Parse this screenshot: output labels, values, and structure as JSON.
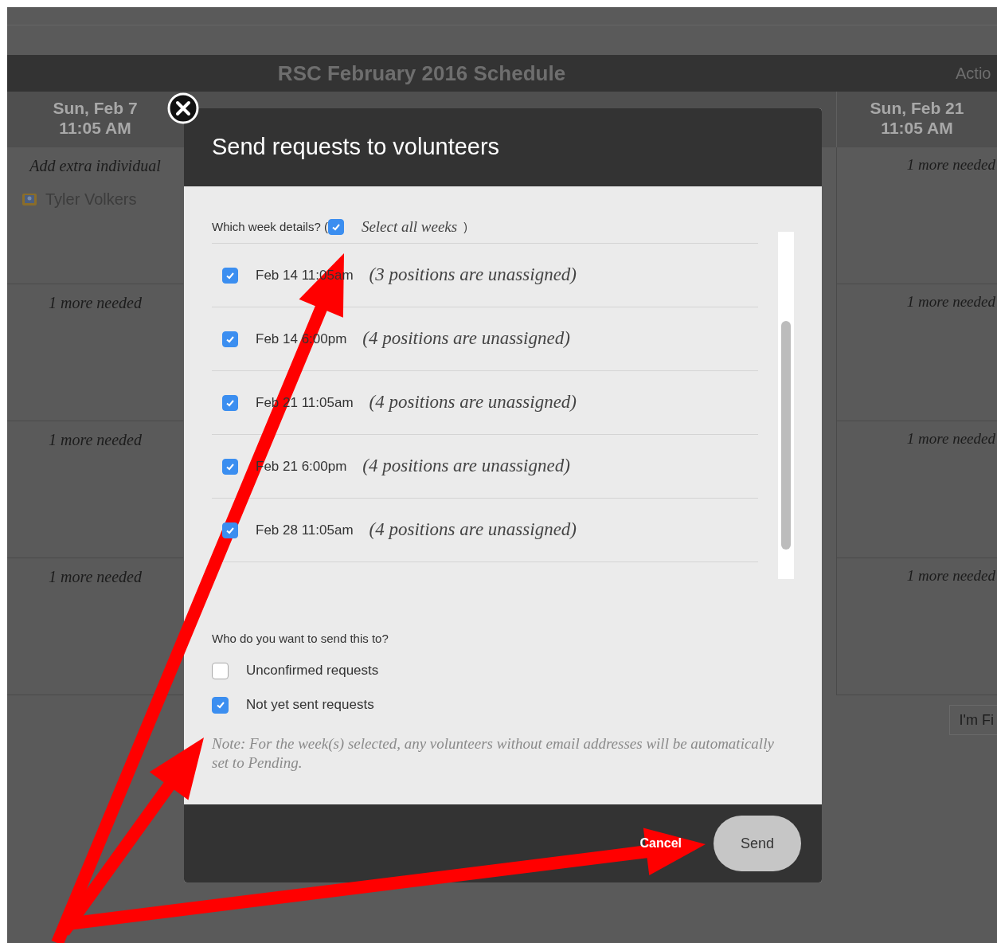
{
  "schedule": {
    "title": "RSC February 2016 Schedule",
    "actions_label": "Actio",
    "columns": [
      {
        "date": "Sun, Feb 7",
        "time": "11:05 AM"
      },
      {
        "date": "Sun, Feb 21",
        "time": "11:05 AM"
      }
    ],
    "first_column": [
      {
        "kind": "add",
        "text": "Add extra individual",
        "person": "Tyler Volkers"
      },
      {
        "kind": "needed",
        "text": "1 more needed"
      },
      {
        "kind": "needed",
        "text": "1 more needed"
      },
      {
        "kind": "needed",
        "text": "1 more needed"
      }
    ],
    "last_column": [
      "1 more needed",
      "1 more needed",
      "1 more needed",
      "1 more needed"
    ],
    "footer_button": "I'm Fi"
  },
  "dialog": {
    "title": "Send requests to volunteers",
    "week_prompt": "Which week details? (",
    "select_all": {
      "label": "Select all weeks",
      "checked": true
    },
    "week_prompt_end": ")",
    "weeks": [
      {
        "label": "Feb 14 11:05am",
        "note": "(3 positions are unassigned)",
        "checked": true
      },
      {
        "label": "Feb 14 6:00pm",
        "note": "(4 positions are unassigned)",
        "checked": true
      },
      {
        "label": "Feb 21 11:05am",
        "note": "(4 positions are unassigned)",
        "checked": true
      },
      {
        "label": "Feb 21 6:00pm",
        "note": "(4 positions are unassigned)",
        "checked": true
      },
      {
        "label": "Feb 28 11:05am",
        "note": "(4 positions are unassigned)",
        "checked": true
      }
    ],
    "recipients_prompt": "Who do you want to send this to?",
    "recipients": [
      {
        "label": "Unconfirmed requests",
        "checked": false
      },
      {
        "label": "Not yet sent requests",
        "checked": true
      }
    ],
    "note": "Note: For the week(s) selected, any volunteers without email addresses will be automatically set to Pending.",
    "cancel": "Cancel",
    "send": "Send"
  }
}
